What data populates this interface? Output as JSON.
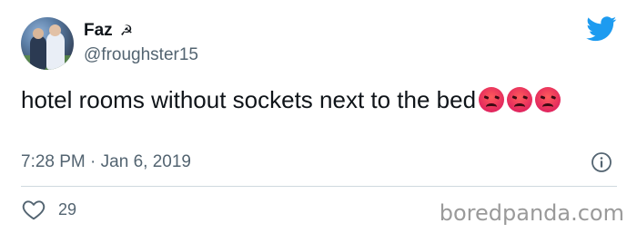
{
  "tweet": {
    "author_name": "Faz",
    "author_symbol": "☭",
    "handle": "@froughster15",
    "text": "hotel rooms without sockets next to the bed",
    "emoji": [
      "angry-face",
      "angry-face",
      "angry-face"
    ],
    "time": "7:28 PM",
    "separator": "·",
    "date": "Jan 6, 2019",
    "likes": "29"
  },
  "icons": {
    "brand": "twitter-bird-icon",
    "info": "info-icon",
    "like": "heart-icon"
  },
  "colors": {
    "twitter_blue": "#1d9bf0",
    "secondary_text": "#536471",
    "emoji_red": "#e0245e"
  },
  "watermark": "boredpanda.com"
}
